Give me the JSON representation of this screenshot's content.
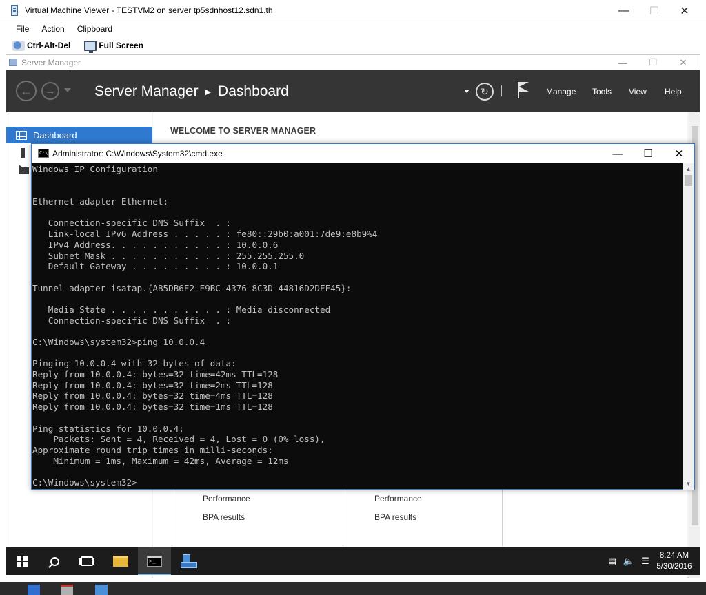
{
  "viewer": {
    "title": "Virtual Machine Viewer - TESTVM2 on server tp5sdnhost12.sdn1.th",
    "controls": {
      "minimize": "—",
      "maximize": "☐",
      "close": "✕"
    },
    "menu": [
      "File",
      "Action",
      "Clipboard"
    ],
    "toolbar": {
      "ctrl_alt_del": "Ctrl-Alt-Del",
      "full_screen": "Full Screen"
    }
  },
  "server_manager": {
    "window_title": "Server Manager",
    "controls": {
      "minimize": "—",
      "restore": "❐",
      "close": "✕"
    },
    "breadcrumb": {
      "app": "Server Manager",
      "page": "Dashboard"
    },
    "menu": [
      "Manage",
      "Tools",
      "View",
      "Help"
    ],
    "sidebar": {
      "active_item": "Dashboard"
    },
    "welcome_heading": "WELCOME TO SERVER MANAGER",
    "tiles": [
      {
        "links": [
          "Performance",
          "BPA results"
        ]
      },
      {
        "links": [
          "Performance",
          "BPA results"
        ]
      }
    ]
  },
  "cmd": {
    "title": "Administrator: C:\\Windows\\System32\\cmd.exe",
    "controls": {
      "minimize": "—",
      "maximize": "☐",
      "close": "✕"
    },
    "lines": [
      "Windows IP Configuration",
      "",
      "",
      "Ethernet adapter Ethernet:",
      "",
      "   Connection-specific DNS Suffix  . :",
      "   Link-local IPv6 Address . . . . . : fe80::29b0:a001:7de9:e8b9%4",
      "   IPv4 Address. . . . . . . . . . . : 10.0.0.6",
      "   Subnet Mask . . . . . . . . . . . : 255.255.255.0",
      "   Default Gateway . . . . . . . . . : 10.0.0.1",
      "",
      "Tunnel adapter isatap.{AB5DB6E2-E9BC-4376-8C3D-44816D2DEF45}:",
      "",
      "   Media State . . . . . . . . . . . : Media disconnected",
      "   Connection-specific DNS Suffix  . :",
      "",
      "C:\\Windows\\system32>ping 10.0.0.4",
      "",
      "Pinging 10.0.0.4 with 32 bytes of data:",
      "Reply from 10.0.0.4: bytes=32 time=42ms TTL=128",
      "Reply from 10.0.0.4: bytes=32 time=2ms TTL=128",
      "Reply from 10.0.0.4: bytes=32 time=4ms TTL=128",
      "Reply from 10.0.0.4: bytes=32 time=1ms TTL=128",
      "",
      "Ping statistics for 10.0.0.4:",
      "    Packets: Sent = 4, Received = 4, Lost = 0 (0% loss),",
      "Approximate round trip times in milli-seconds:",
      "    Minimum = 1ms, Maximum = 42ms, Average = 12ms",
      "",
      "C:\\Windows\\system32>"
    ]
  },
  "taskbar": {
    "clock": {
      "time": "8:24 AM",
      "date": "5/30/2016"
    }
  },
  "colors": {
    "accent": "#2f7ad0",
    "sm_header": "#353535",
    "console_bg": "#0c0c0c",
    "console_fg": "#c0c0c0",
    "taskbar_bg": "#1c1c1c"
  }
}
